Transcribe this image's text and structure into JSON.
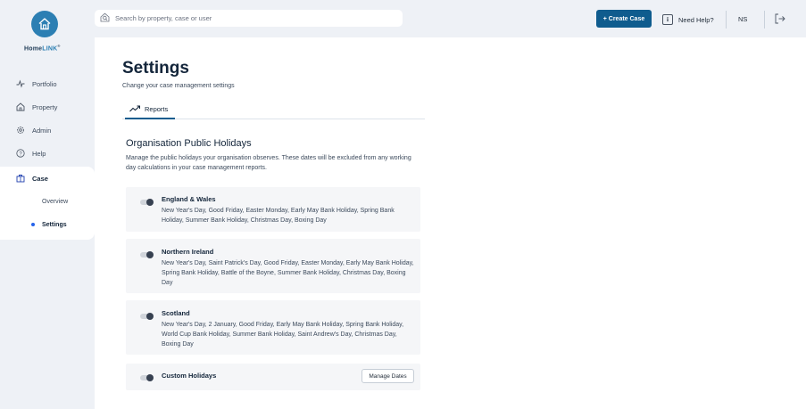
{
  "brand": {
    "name_part1": "Home",
    "name_part2": "LINK",
    "trademark": "®",
    "accent_color": "#2c7fb3"
  },
  "search": {
    "placeholder": "Search by property, case or user",
    "value": ""
  },
  "header": {
    "create_label": "+ Create Case",
    "help_label": "Need Help?",
    "user_initials": "NS",
    "primary_color": "#0f5c8e"
  },
  "sidebar": {
    "items": [
      {
        "label": "Portfolio",
        "icon": "pulse-icon"
      },
      {
        "label": "Property",
        "icon": "house-icon"
      },
      {
        "label": "Admin",
        "icon": "gear-icon"
      },
      {
        "label": "Help",
        "icon": "question-icon"
      },
      {
        "label": "Case",
        "icon": "briefcase-icon"
      }
    ],
    "case_sub": [
      {
        "label": "Overview"
      },
      {
        "label": "Settings"
      }
    ]
  },
  "page": {
    "title": "Settings",
    "subtitle": "Change your case management settings",
    "tabs": [
      {
        "label": "Reports",
        "icon": "trend-icon"
      }
    ]
  },
  "holidays": {
    "title": "Organisation Public Holidays",
    "description": "Manage the public holidays your organisation observes. These dates will be excluded from any working day calculations in your case management reports.",
    "regions": [
      {
        "name": "England & Wales",
        "enabled": false,
        "dates": "New Year's Day, Good Friday, Easter Monday, Early May Bank Holiday, Spring Bank Holiday, Summer Bank Holiday, Christmas Day, Boxing Day"
      },
      {
        "name": "Northern Ireland",
        "enabled": false,
        "dates": "New Year's Day, Saint Patrick's Day, Good Friday, Easter Monday, Early May Bank Holiday, Spring Bank Holiday, Battle of the Boyne, Summer Bank Holiday, Christmas Day, Boxing Day"
      },
      {
        "name": "Scotland",
        "enabled": false,
        "dates": "New Year's Day, 2 January, Good Friday, Early May Bank Holiday, Spring Bank Holiday, World Cup Bank Holiday, Summer Bank Holiday, Saint Andrew's Day, Christmas Day, Boxing Day"
      },
      {
        "name": "Custom Holidays",
        "enabled": false,
        "dates": "",
        "button": "Manage Dates"
      }
    ]
  }
}
